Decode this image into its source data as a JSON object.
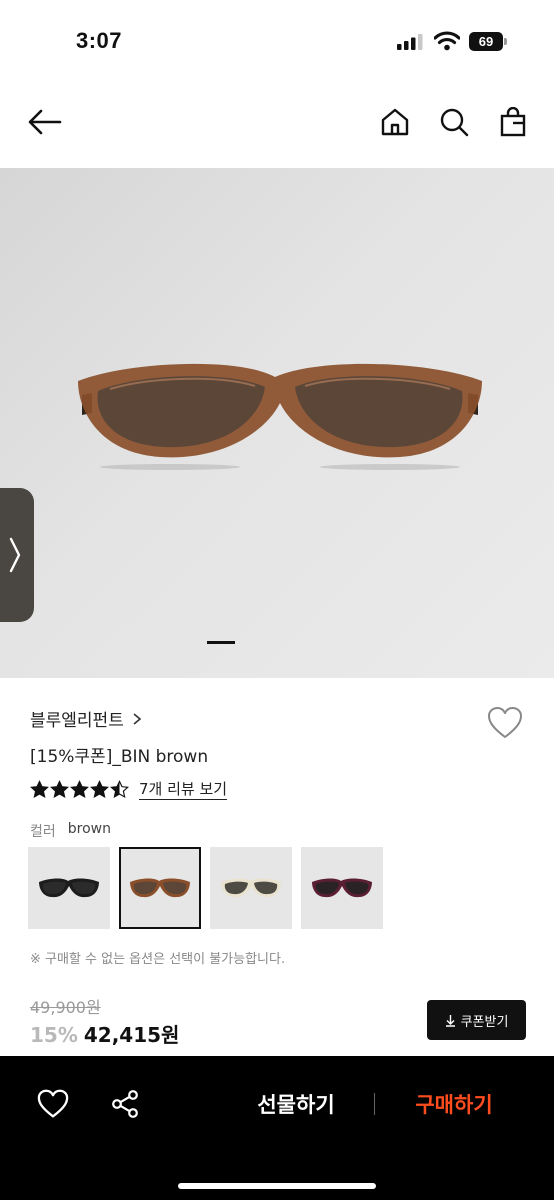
{
  "status": {
    "time": "3:07",
    "battery": "69"
  },
  "product": {
    "brand": "블루엘리펀트",
    "name": "[15%쿠폰]_BIN brown",
    "rating": 4.5,
    "review_link": "7개 리뷰 보기",
    "color_label": "컬러",
    "color_value": "brown",
    "swatches": [
      {
        "frame": "#1c1c1c",
        "lens": "#2b2b2b"
      },
      {
        "frame": "#8a4f2a",
        "lens": "#5b4638"
      },
      {
        "frame": "#e8e2cf",
        "lens": "#4e4b44"
      },
      {
        "frame": "#5a1f33",
        "lens": "#2a2326"
      }
    ],
    "selected_swatch": 1,
    "notice": "※ 구매할 수 없는 옵션은 선택이 불가능합니다.",
    "original_price": "49,900원",
    "discount": "15%",
    "price": "42,415원",
    "coupon_label": "쿠폰받기"
  },
  "bottom_bar": {
    "gift_label": "선물하기",
    "buy_label": "구매하기"
  },
  "colors": {
    "buy_accent": "#ff4c1f",
    "frame_brown": "#8a4f2a",
    "lens_brown": "#5b4638"
  },
  "icons": [
    "back-arrow-icon",
    "home-icon",
    "search-icon",
    "shopping-bag-icon",
    "heart-icon",
    "share-icon",
    "chevron-right-icon",
    "download-icon",
    "star-icon"
  ]
}
